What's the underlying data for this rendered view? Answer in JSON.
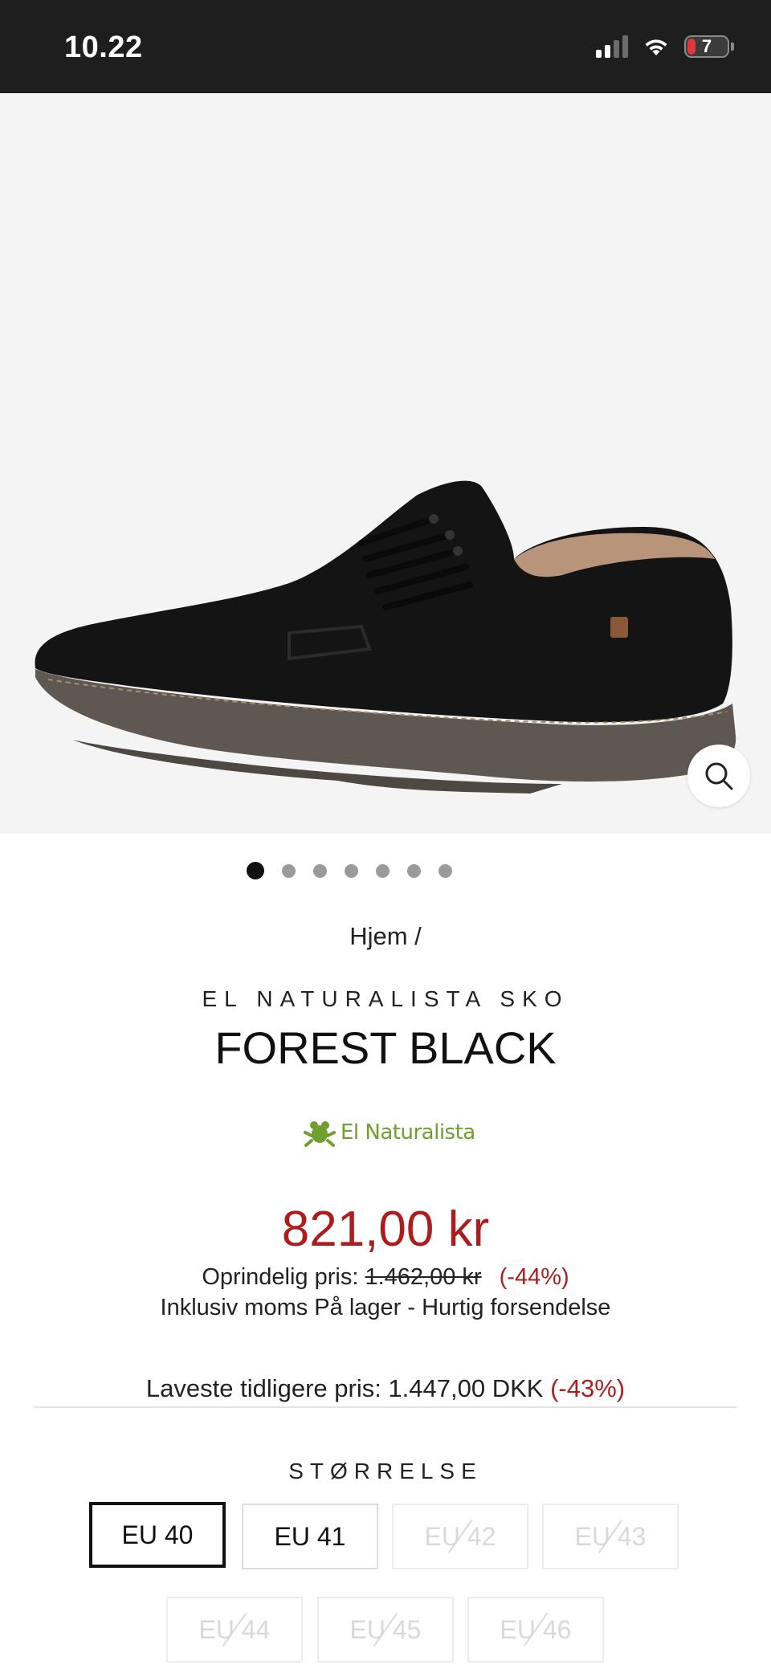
{
  "status_bar": {
    "time": "10.22",
    "battery": "7"
  },
  "breadcrumb": "Hjem /",
  "product": {
    "brand": "EL NATURALISTA SKO",
    "title": "FOREST BLACK",
    "logo_text": "El Naturalista"
  },
  "gallery": {
    "total_images": 7,
    "active_index": 0
  },
  "pricing": {
    "price": "821,00 kr",
    "original_label": "Oprindelig pris:",
    "original_price": "1.462,00 kr",
    "discount": "(-44%)",
    "stock_info": "Inklusiv moms På lager - Hurtig forsendelse",
    "lowest_label": "Laveste tidligere pris: 1.447,00 DKK",
    "lowest_discount": "(-43%)"
  },
  "size": {
    "title": "STØRRELSE",
    "options": [
      {
        "label": "EU 40",
        "state": "selected"
      },
      {
        "label": "EU 41",
        "state": "available"
      },
      {
        "label": "EU 42",
        "state": "unavailable"
      },
      {
        "label": "EU 43",
        "state": "unavailable"
      },
      {
        "label": "EU 44",
        "state": "unavailable"
      },
      {
        "label": "EU 45",
        "state": "unavailable"
      },
      {
        "label": "EU 46",
        "state": "unavailable"
      }
    ]
  },
  "colors": {
    "price_red": "#ad1d1d",
    "logo_green": "#6f9f2e"
  }
}
